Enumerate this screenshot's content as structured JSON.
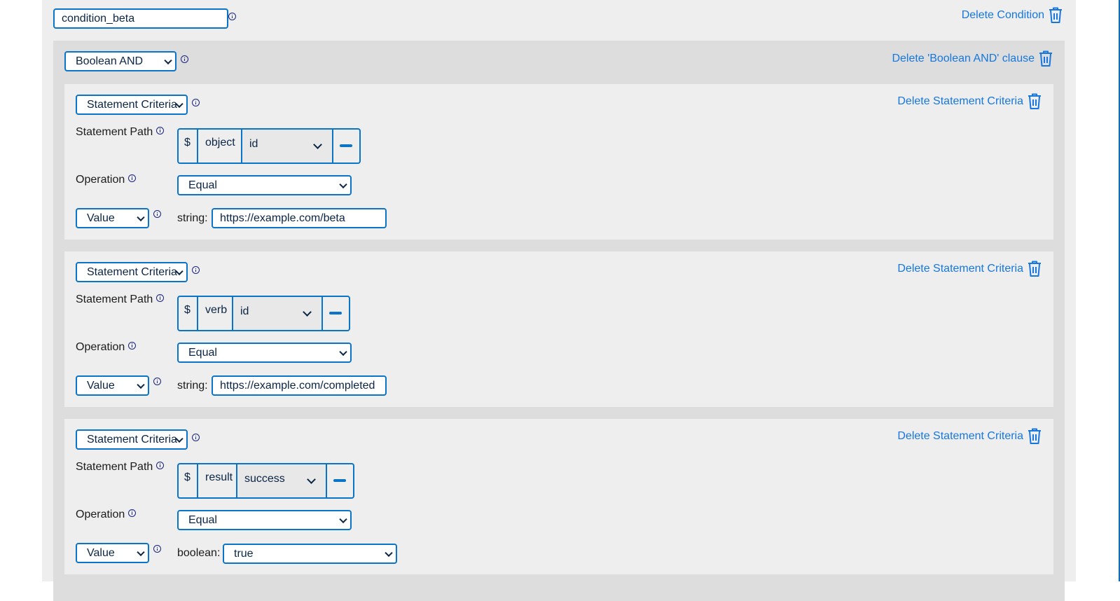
{
  "condition": {
    "name_value": "condition_beta",
    "delete_label": "Delete Condition",
    "clause": {
      "type_selected": "Boolean AND",
      "delete_label": "Delete 'Boolean AND' clause",
      "criteria": [
        {
          "type_selected": "Statement Criteria",
          "delete_label": "Delete Statement Criteria",
          "path_label": "Statement Path",
          "path": {
            "root": "$",
            "segment": "object",
            "selected": "id"
          },
          "operation_label": "Operation",
          "operation_selected": "Equal",
          "value_mode_selected": "Value",
          "value_type_label": "string:",
          "value": "https://example.com/beta"
        },
        {
          "type_selected": "Statement Criteria",
          "delete_label": "Delete Statement Criteria",
          "path_label": "Statement Path",
          "path": {
            "root": "$",
            "segment": "verb",
            "selected": "id"
          },
          "operation_label": "Operation",
          "operation_selected": "Equal",
          "value_mode_selected": "Value",
          "value_type_label": "string:",
          "value": "https://example.com/completed"
        },
        {
          "type_selected": "Statement Criteria",
          "delete_label": "Delete Statement Criteria",
          "path_label": "Statement Path",
          "path": {
            "root": "$",
            "segment": "result",
            "selected": "success"
          },
          "operation_label": "Operation",
          "operation_selected": "Equal",
          "value_mode_selected": "Value",
          "value_type_label": "boolean:",
          "value": "true"
        }
      ]
    }
  },
  "icons": {
    "info": "info-circle-icon",
    "delete": "trash-icon",
    "remove": "minus-icon",
    "dropdown": "chevron-down-icon"
  },
  "colors": {
    "accent": "#0a74c9",
    "link": "#1677e0",
    "panel": "#eeeeee",
    "clause_panel": "#dddddd",
    "text": "#0b2545"
  }
}
